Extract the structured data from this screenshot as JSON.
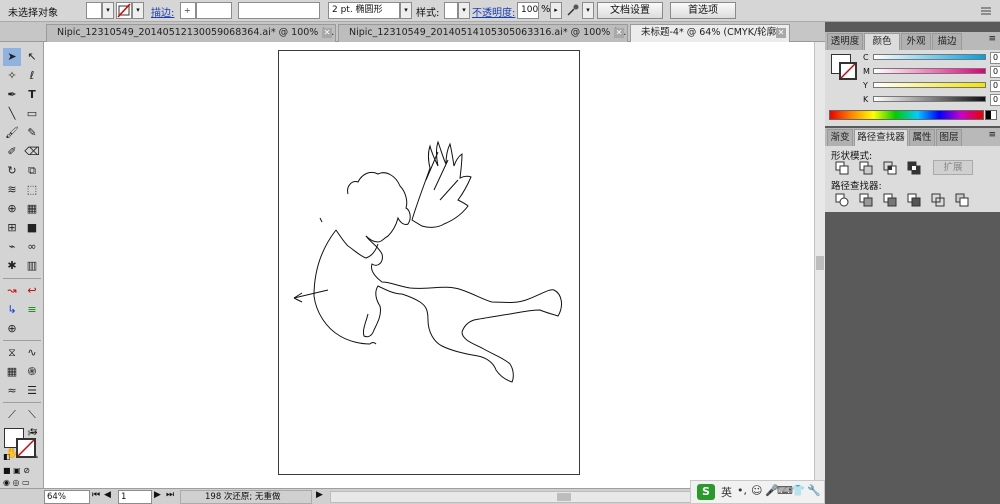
{
  "control_bar": {
    "selection_label": "未选择对象",
    "stroke_link": "描边:",
    "brush_size": "2 pt. 椭圆形",
    "style_label": "样式:",
    "opacity_link": "不透明度:",
    "opacity_value": "100",
    "opacity_unit": "%",
    "doc_setup_button": "文档设置",
    "preferences_button": "首选项"
  },
  "tabs": [
    {
      "label": "Nipic_12310549_20140512130059068364.ai* @ 100% (R...",
      "active": false
    },
    {
      "label": "Nipic_12310549_20140514105305063316.ai* @ 100% (R...",
      "active": false
    },
    {
      "label": "未标题-4* @ 64% (CMYK/轮廓)",
      "active": true
    }
  ],
  "status_bar": {
    "zoom": "64%",
    "page": "1",
    "history": "198 次还原; 无重做"
  },
  "color_panel": {
    "tabs": [
      "透明度",
      "颜色",
      "外观",
      "描边"
    ],
    "active_tab": "颜色",
    "channels": [
      {
        "label": "C",
        "value": "0",
        "unit": "%",
        "color": "#00a0e0"
      },
      {
        "label": "M",
        "value": "0",
        "unit": "%",
        "color": "#e0007a"
      },
      {
        "label": "Y",
        "value": "0",
        "unit": "%",
        "color": "#f2e500"
      },
      {
        "label": "K",
        "value": "0",
        "unit": "%",
        "color": "#111111"
      }
    ]
  },
  "pathfinder_panel": {
    "tabs": [
      "渐变",
      "路径查找器",
      "属性",
      "图层"
    ],
    "active_tab": "路径查找器",
    "shape_modes_label": "形状模式:",
    "expand_button": "扩展",
    "pathfinders_label": "路径查找器:"
  },
  "taskbar": {
    "ime_logo": "S",
    "ime_lang": "英"
  }
}
